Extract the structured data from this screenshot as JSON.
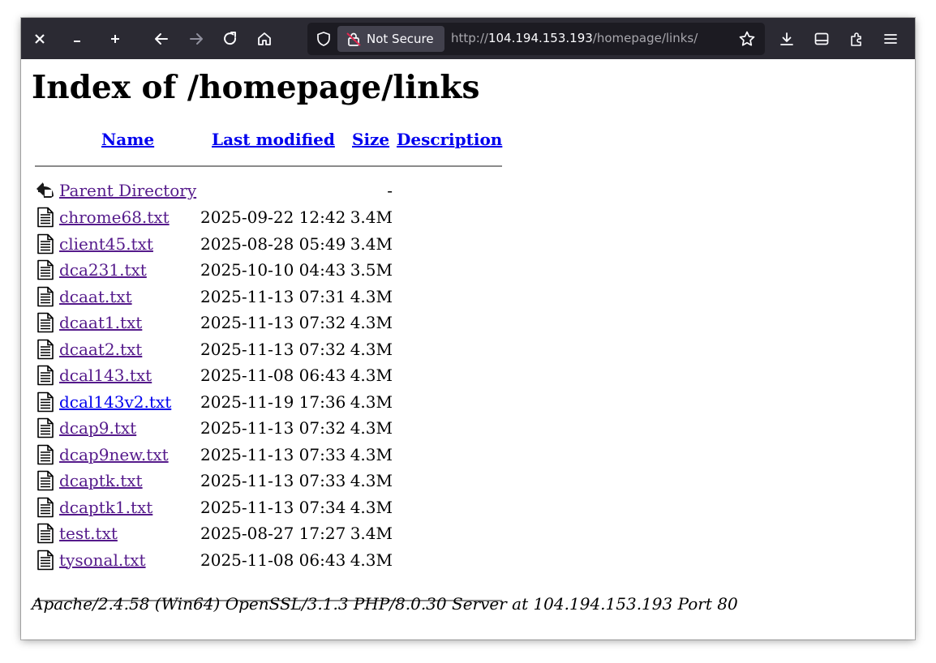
{
  "browser": {
    "security_label": "Not Secure",
    "url_scheme": "http://",
    "url_host": "104.194.153.193",
    "url_path": "/homepage/links/",
    "icons": [
      "close-icon",
      "minimize-icon",
      "maximize-icon",
      "back-icon",
      "forward-icon",
      "reload-icon",
      "home-icon",
      "shield-icon",
      "insecure-lock-icon",
      "bookmark-star-icon",
      "download-icon",
      "reader-view-icon",
      "extensions-icon",
      "menu-icon"
    ]
  },
  "page": {
    "title": "Index of /homepage/links",
    "columns": {
      "name": "Name",
      "last_modified": "Last modified",
      "size": "Size",
      "description": "Description"
    },
    "parent": {
      "label": "Parent Directory",
      "size": "-"
    },
    "files": [
      {
        "name": "chrome68.txt",
        "modified": "2025-09-22 12:42",
        "size": "3.4M",
        "visited": true
      },
      {
        "name": "client45.txt",
        "modified": "2025-08-28 05:49",
        "size": "3.4M",
        "visited": true
      },
      {
        "name": "dca231.txt",
        "modified": "2025-10-10 04:43",
        "size": "3.5M",
        "visited": true
      },
      {
        "name": "dcaat.txt",
        "modified": "2025-11-13 07:31",
        "size": "4.3M",
        "visited": true
      },
      {
        "name": "dcaat1.txt",
        "modified": "2025-11-13 07:32",
        "size": "4.3M",
        "visited": true
      },
      {
        "name": "dcaat2.txt",
        "modified": "2025-11-13 07:32",
        "size": "4.3M",
        "visited": true
      },
      {
        "name": "dcal143.txt",
        "modified": "2025-11-08 06:43",
        "size": "4.3M",
        "visited": true
      },
      {
        "name": "dcal143v2.txt",
        "modified": "2025-11-19 17:36",
        "size": "4.3M",
        "visited": false
      },
      {
        "name": "dcap9.txt",
        "modified": "2025-11-13 07:32",
        "size": "4.3M",
        "visited": true
      },
      {
        "name": "dcap9new.txt",
        "modified": "2025-11-13 07:33",
        "size": "4.3M",
        "visited": true
      },
      {
        "name": "dcaptk.txt",
        "modified": "2025-11-13 07:33",
        "size": "4.3M",
        "visited": true
      },
      {
        "name": "dcaptk1.txt",
        "modified": "2025-11-13 07:34",
        "size": "4.3M",
        "visited": true
      },
      {
        "name": "test.txt",
        "modified": "2025-08-27 17:27",
        "size": "3.4M",
        "visited": true
      },
      {
        "name": "tysonal.txt",
        "modified": "2025-11-08 06:43",
        "size": "4.3M",
        "visited": true
      }
    ],
    "server_signature": "Apache/2.4.58 (Win64) OpenSSL/3.1.3 PHP/8.0.30 Server at 104.194.153.193 Port 80"
  },
  "colors": {
    "toolbar_bg": "#2b2a33",
    "urlbar_bg": "#1c1b22",
    "link": "#0000ee",
    "visited_link": "#551a8b"
  }
}
